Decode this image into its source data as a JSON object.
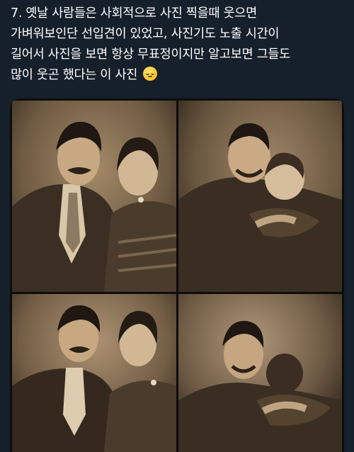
{
  "tweet": {
    "text_lines": [
      "7. 옛날 사람들은 사회적으로 사진 찍을때 웃으면",
      "가벼워보인단 선입견이 있었고, 사진기도 노출 시간이",
      "길어서 사진을 보면 항상 무표정이지만 알고보면 그들도",
      "많이 웃곤 했다는 이 사진"
    ],
    "emoji": "relieved-face-emoji"
  },
  "media": {
    "frames": [
      {
        "description_icon": "photo-serious-couple"
      },
      {
        "description_icon": "photo-laughing-couple"
      },
      {
        "description_icon": "photo-serious-couple"
      },
      {
        "description_icon": "photo-laughing-couple"
      }
    ]
  },
  "colors": {
    "background": "#15202b",
    "text": "#ffffff",
    "sepia_dark": "#2a2017",
    "sepia_light": "#a48a68"
  }
}
